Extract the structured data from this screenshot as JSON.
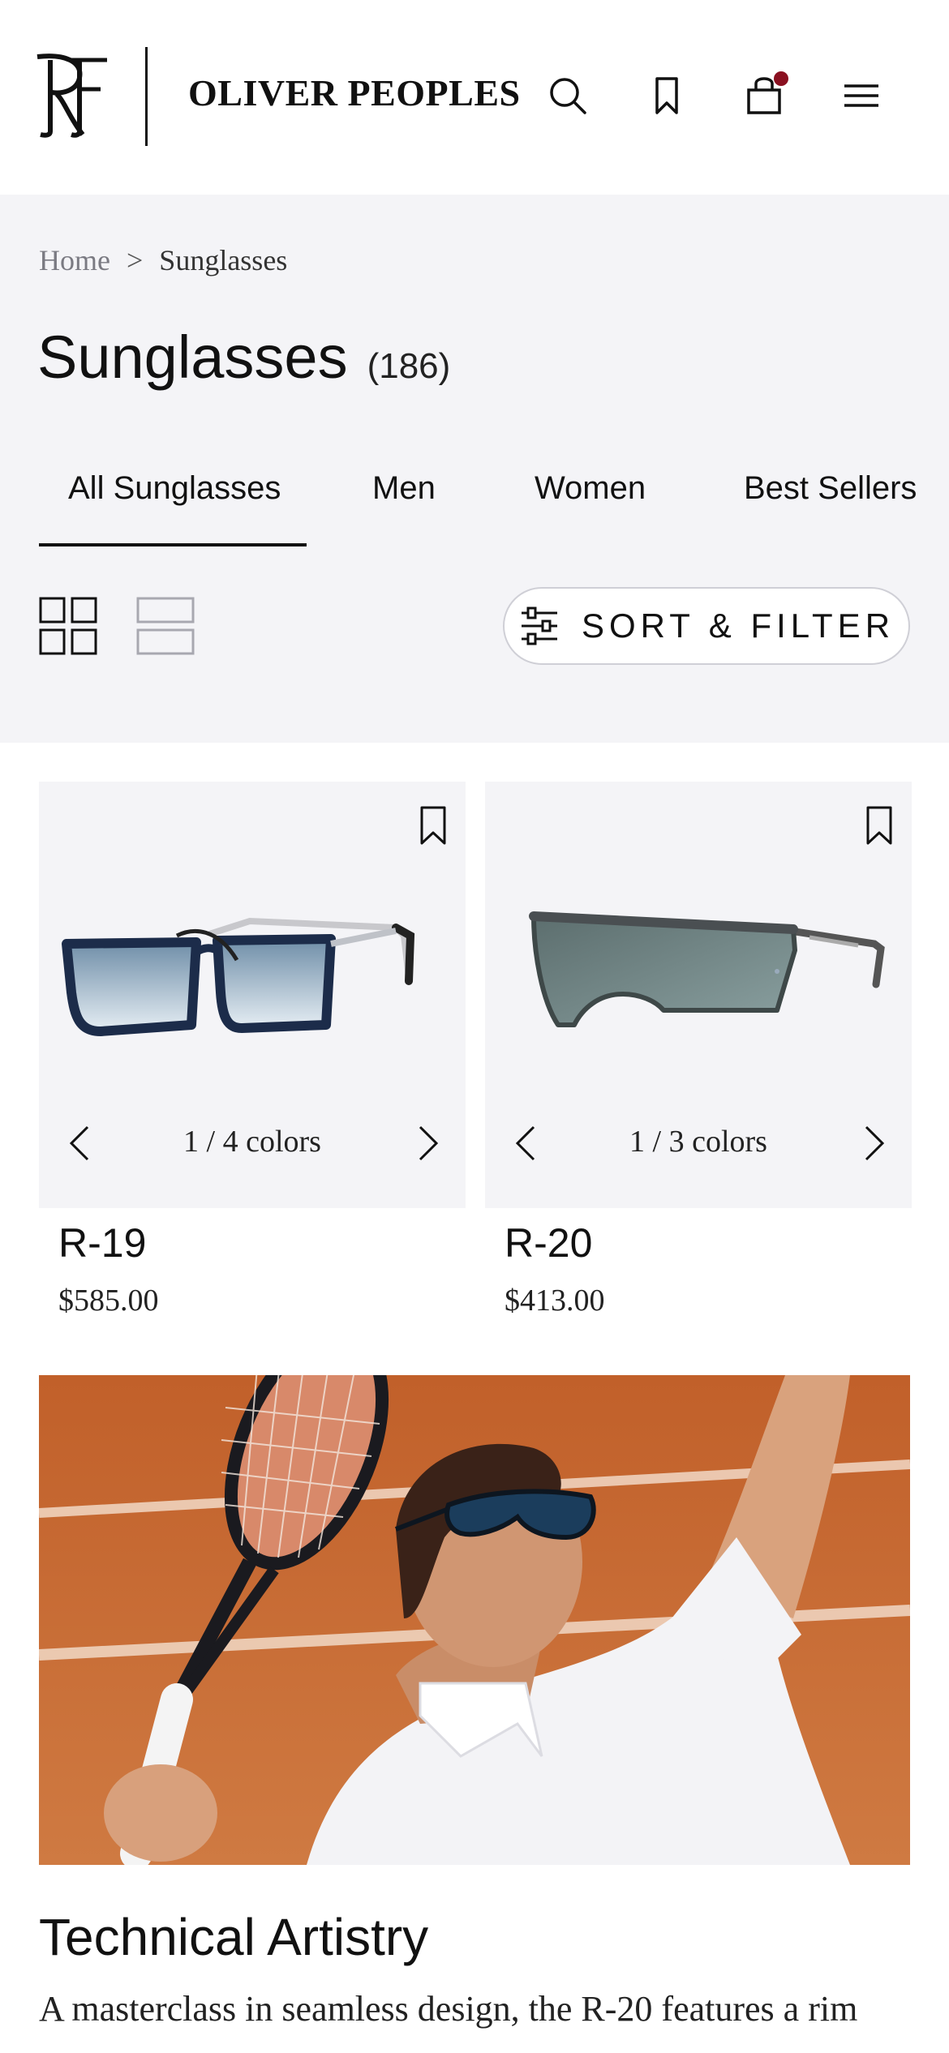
{
  "header": {
    "brand": "OLIVER PEOPLES",
    "icons": [
      "search-icon",
      "bookmark-icon",
      "bag-icon",
      "menu-icon"
    ],
    "cart_indicator_color": "#8a1020"
  },
  "breadcrumb": {
    "home": "Home",
    "separator": ">",
    "current": "Sunglasses"
  },
  "page": {
    "title": "Sunglasses",
    "count": "(186)"
  },
  "tabs": [
    {
      "label": "All Sunglasses",
      "active": true
    },
    {
      "label": "Men",
      "active": false
    },
    {
      "label": "Women",
      "active": false
    },
    {
      "label": "Best Sellers",
      "active": false
    }
  ],
  "toolbar": {
    "sort_filter_label": "SORT & FILTER",
    "view_modes": [
      "grid-view-icon",
      "list-view-icon"
    ],
    "active_view": "grid"
  },
  "products": [
    {
      "name": "R-19",
      "price": "$585.00",
      "colors": "1 / 4 colors"
    },
    {
      "name": "R-20",
      "price": "$413.00",
      "colors": "1 / 3 colors"
    }
  ],
  "story": {
    "title": "Technical Artistry",
    "text": "A masterclass in seamless design, the R-20 features a rim"
  },
  "colors": {
    "page_bg": "#f4f4f7",
    "text": "#111111",
    "court": "#c8672e"
  }
}
